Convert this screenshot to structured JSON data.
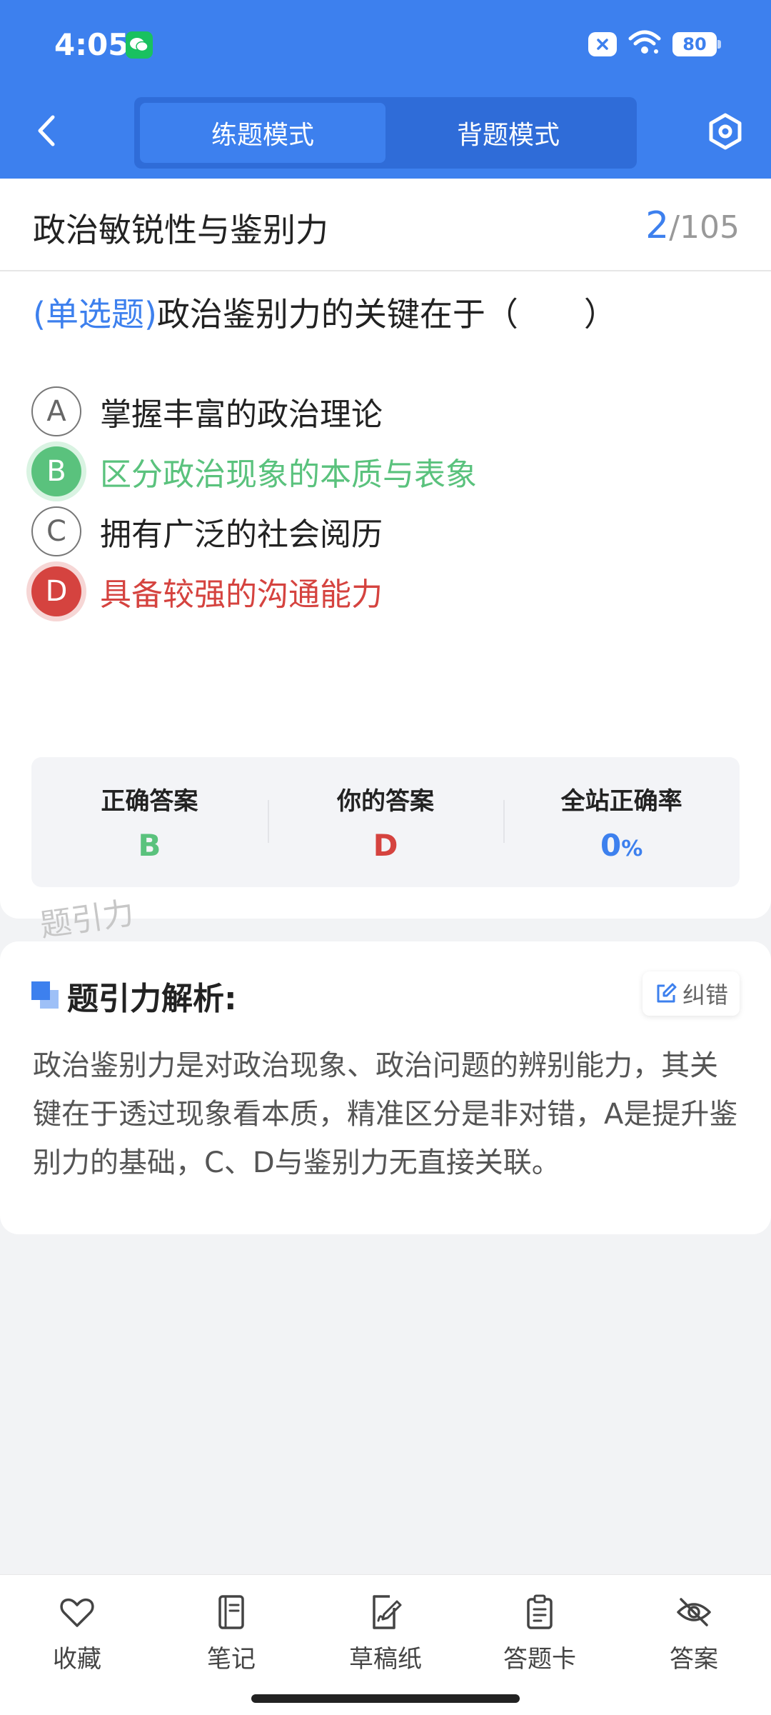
{
  "status_bar": {
    "time": "4:05",
    "battery": "80"
  },
  "header": {
    "tabs": [
      {
        "label": "练题模式",
        "active": true
      },
      {
        "label": "背题模式",
        "active": false
      }
    ]
  },
  "section": {
    "title": "政治敏锐性与鉴别力",
    "current": "2",
    "total": "/105"
  },
  "question": {
    "type": "(单选题)",
    "text": "政治鉴别力的关键在于（　　）",
    "options": [
      {
        "letter": "A",
        "text": "掌握丰富的政治理论",
        "state": "normal"
      },
      {
        "letter": "B",
        "text": "区分政治现象的本质与表象",
        "state": "correct"
      },
      {
        "letter": "C",
        "text": "拥有广泛的社会阅历",
        "state": "normal"
      },
      {
        "letter": "D",
        "text": "具备较强的沟通能力",
        "state": "wrong"
      }
    ]
  },
  "answers": {
    "correct_label": "正确答案",
    "correct_value": "B",
    "yours_label": "你的答案",
    "yours_value": "D",
    "rate_label": "全站正确率",
    "rate_value": "0",
    "rate_unit": "%"
  },
  "watermark": "题引力",
  "analysis": {
    "title": "题引力解析:",
    "report_label": "纠错",
    "text": "政治鉴别力是对政治现象、政治问题的辨别能力，其关键在于透过现象看本质，精准区分是非对错，A是提升鉴别力的基础，C、D与鉴别力无直接关联。"
  },
  "bottom_bar": [
    {
      "label": "收藏",
      "icon": "heart-icon"
    },
    {
      "label": "笔记",
      "icon": "notebook-icon"
    },
    {
      "label": "草稿纸",
      "icon": "draft-icon"
    },
    {
      "label": "答题卡",
      "icon": "answer-card-icon"
    },
    {
      "label": "答案",
      "icon": "eye-off-icon"
    }
  ],
  "colors": {
    "primary": "#3d80ee",
    "correct": "#5ac27d",
    "wrong": "#d5433f"
  }
}
